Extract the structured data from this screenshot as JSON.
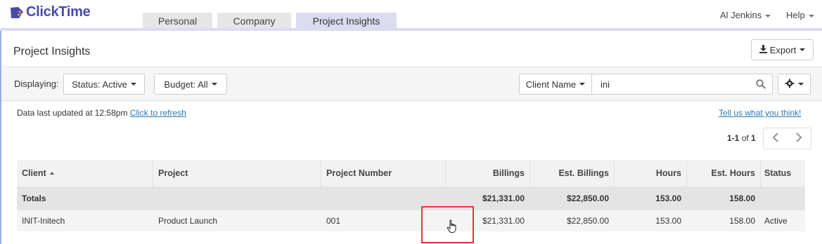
{
  "app": {
    "name": "ClickTime",
    "brand_color": "#4a4aa8",
    "accent_rule_color": "#dcdcf0"
  },
  "tabs": [
    {
      "label": "Personal",
      "active": false
    },
    {
      "label": "Company",
      "active": false
    },
    {
      "label": "Project Insights",
      "active": true
    }
  ],
  "user_menu": {
    "label": "Al Jenkins",
    "icon": "caret-down-icon"
  },
  "help_menu": {
    "label": "Help",
    "icon": "caret-down-icon"
  },
  "page": {
    "title": "Project Insights",
    "export_label": "Export",
    "export_icon": "download-icon"
  },
  "filters": {
    "displaying_label": "Displaying:",
    "status_label": "Status: Active",
    "budget_label": "Budget: All",
    "search_field_label": "Client Name",
    "search_value": "ini",
    "search_icon": "search-icon",
    "settings_icon": "gear-icon"
  },
  "info": {
    "updated_text": "Data last updated at 12:58pm",
    "refresh_link": "Click to refresh",
    "feedback_link": "Tell us what you think!"
  },
  "pager": {
    "range": "1-1",
    "of_label": "of",
    "total": "1"
  },
  "table": {
    "columns": [
      "Client",
      "Project",
      "Project Number",
      "Billings",
      "Est. Billings",
      "Hours",
      "Est. Hours",
      "Status"
    ],
    "sort_column": "Client",
    "sort_direction": "ascending",
    "totals": {
      "label": "Totals",
      "billings": "$21,331.00",
      "est_billings": "$22,850.00",
      "hours": "153.00",
      "est_hours": "158.00"
    },
    "rows": [
      {
        "client": "INIT-Initech",
        "project": "Product Launch",
        "number": "001",
        "billings": "$21,331.00",
        "est_billings": "$22,850.00",
        "hours": "153.00",
        "est_hours": "158.00",
        "status": "Active"
      }
    ]
  },
  "annotation": {
    "highlight_color": "#e0393c",
    "cursor_icon": "hand-pointer-icon"
  }
}
